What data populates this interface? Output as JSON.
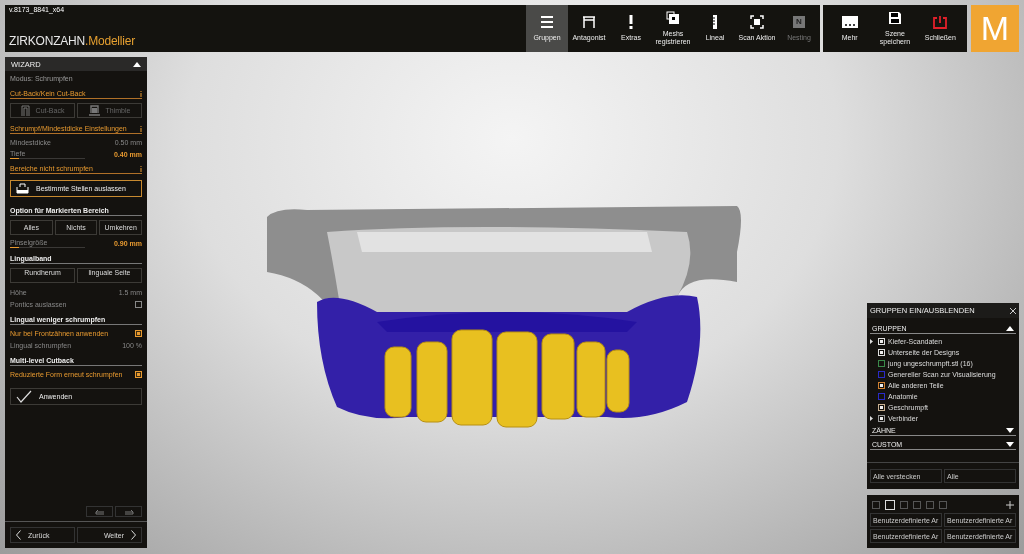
{
  "version": "v.8173_8841_x64",
  "brand": {
    "name": "ZIRKONZAHN",
    "product": ".Modellier"
  },
  "toolbar": [
    {
      "label": "Gruppen",
      "selected": true,
      "disabled": false
    },
    {
      "label": "Antagonist",
      "selected": false,
      "disabled": false
    },
    {
      "label": "Extras",
      "selected": false,
      "disabled": false
    },
    {
      "label": "Meshs registrieren",
      "selected": false,
      "disabled": false
    },
    {
      "label": "Lineal",
      "selected": false,
      "disabled": false
    },
    {
      "label": "Scan Aktion",
      "selected": false,
      "disabled": false
    },
    {
      "label": "Nesting",
      "selected": false,
      "disabled": true
    }
  ],
  "nesting_glyph": "N",
  "toolbar_right": [
    {
      "label": "Mehr"
    },
    {
      "label": "Szene speichern"
    },
    {
      "label": "Schließen"
    }
  ],
  "logo_letter": "M",
  "wizard": {
    "title": "WIZARD",
    "expanded": true,
    "mode": "Modus: Schrumpfen",
    "blocks": [
      {
        "kind": "group-heading",
        "text": "Cut-Back/Kein Cut-Back"
      },
      {
        "kind": "icon-buttons",
        "items": [
          {
            "label": "Cut-Back",
            "disabled": true
          },
          {
            "label": "Thimble",
            "disabled": true
          }
        ]
      },
      {
        "kind": "group-heading",
        "text": "Schrumpf/Mindestdicke Einstellungen"
      },
      {
        "kind": "value",
        "label": "Mindestdicke",
        "value": "0.50",
        "unit": "mm"
      },
      {
        "kind": "slider",
        "label": "Tiefe",
        "value": "0.40",
        "unit": "mm",
        "level": 0.12
      },
      {
        "kind": "group-heading",
        "text": "Bereiche nicht schrumpfen"
      },
      {
        "kind": "action",
        "label": "Bestimmte Stellen auslassen"
      },
      {
        "kind": "heading",
        "text": "Option für Markierten Bereich"
      },
      {
        "kind": "buttons",
        "items": [
          {
            "label": "Alles",
            "disabled": false
          },
          {
            "label": "Nichts",
            "disabled": false
          },
          {
            "label": "Umkehren",
            "disabled": false
          }
        ]
      },
      {
        "kind": "slider",
        "label": "Pinselgröße",
        "value": "0.90",
        "unit": "mm",
        "level": 0.12
      },
      {
        "kind": "heading",
        "text": "Lingualband"
      },
      {
        "kind": "buttons",
        "items": [
          {
            "label": "Rundherum",
            "disabled": false
          },
          {
            "label": "linguale Seite",
            "disabled": false
          }
        ]
      },
      {
        "kind": "value",
        "label": "Höhe",
        "value": "1.5",
        "unit": "mm"
      },
      {
        "kind": "checkbox",
        "label": "Pontics auslassen",
        "checked": false
      },
      {
        "kind": "heading",
        "text": "Lingual weniger schrumpfen"
      },
      {
        "kind": "checkbox",
        "label": "Nur bei Frontzähnen anwenden",
        "checked": true
      },
      {
        "kind": "value",
        "label": "Lingual schrumpfen",
        "value": "100",
        "unit": "%"
      },
      {
        "kind": "heading",
        "text": "Multi-level Cutback"
      },
      {
        "kind": "checkbox",
        "label": "Reduzierte Form erneut schrumpfen",
        "checked": true
      },
      {
        "kind": "apply",
        "label": "Anwenden"
      }
    ]
  },
  "nav": {
    "back": "Zurück",
    "next": "Weiter"
  },
  "groups_panel": {
    "title": "GRUPPEN EIN/AUSBLENDEN",
    "sections": [
      {
        "title": "GRUPPEN",
        "expanded": true,
        "items": [
          {
            "label": "Kiefer-Scandaten",
            "checked": true,
            "expandable": true,
            "color": "#e0e0e0"
          },
          {
            "label": "Unterseite der Designs",
            "checked": true,
            "expandable": false,
            "color": "#e0e0e0"
          },
          {
            "label": "jung ungeschrumpft.stl (16)",
            "checked": false,
            "expandable": false,
            "color": "#3a8a4a"
          },
          {
            "label": "Genereller Scan zur Visualisierung",
            "checked": false,
            "expandable": false,
            "color": "#2a2ac8"
          },
          {
            "label": "Alle anderen Teile",
            "checked": true,
            "expandable": false,
            "color": "#d08030"
          },
          {
            "label": "Anatomie",
            "checked": false,
            "expandable": false,
            "color": "#2a2ac8"
          },
          {
            "label": "Geschrumpft",
            "checked": true,
            "expandable": false,
            "color": "#c8b090"
          },
          {
            "label": "Verbinder",
            "checked": true,
            "expandable": true,
            "color": "#9a9a9a"
          }
        ]
      },
      {
        "title": "ZÄHNE",
        "expanded": false
      },
      {
        "title": "CUSTOM",
        "expanded": false
      }
    ],
    "buttons": [
      "Alle verstecken",
      "Alle"
    ]
  },
  "view_presets": [
    {
      "selected": false
    },
    {
      "selected": true
    },
    {
      "selected": false
    },
    {
      "selected": false
    },
    {
      "selected": false
    },
    {
      "selected": false
    }
  ],
  "custom_buttons": [
    "Benutzerdefinierte Ar",
    "Benutzerdefinierte Ar",
    "Benutzerdefinierte Ar",
    "Benutzerdefinierte Ar"
  ]
}
